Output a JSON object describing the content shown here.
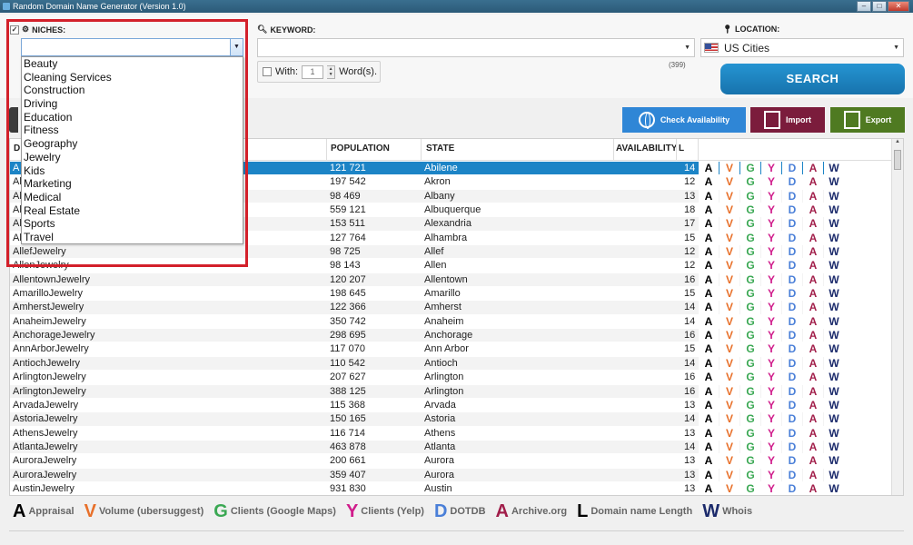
{
  "window": {
    "title": "Random Domain Name Generator (Version 1.0)"
  },
  "niches": {
    "label": "NICHES:",
    "checked": true,
    "value": "",
    "options": [
      "Beauty",
      "Cleaning Services",
      "Construction",
      "Driving",
      "Education",
      "Fitness",
      "Geography",
      "Jewelry",
      "Kids",
      "Marketing",
      "Medical",
      "Real Estate",
      "Sports",
      "Travel"
    ]
  },
  "keyword": {
    "label": "KEYWORD:",
    "value": "",
    "with_label": "With:",
    "with_value": "1",
    "words_label": "Word(s).",
    "count": "(399)"
  },
  "location": {
    "label": "LOCATION:",
    "value": "US Cities"
  },
  "buttons": {
    "search": "SEARCH",
    "check_availability": "Check Availability",
    "import": "Import",
    "export": "Export"
  },
  "colors": {
    "appraisal": "#000000",
    "volume": "#e8702a",
    "google": "#3aa853",
    "yelp": "#d01c8b",
    "dotdb": "#4a7fd8",
    "archive": "#a11e4a",
    "whois": "#1b2a6b",
    "selection": "#1c84c6"
  },
  "table": {
    "headers": {
      "domain": "D",
      "population": "POPULATION",
      "state": "STATE",
      "availability": "AVAILABILITY",
      "length": "L"
    },
    "letters": [
      "A",
      "V",
      "G",
      "Y",
      "D",
      "A",
      "W"
    ],
    "rows": [
      {
        "domain": "A",
        "population": "121 721",
        "state": "Abilene",
        "length": "14",
        "selected": true
      },
      {
        "domain": "Al",
        "population": "197 542",
        "state": "Akron",
        "length": "12"
      },
      {
        "domain": "Al",
        "population": "98 469",
        "state": "Albany",
        "length": "13"
      },
      {
        "domain": "Al",
        "population": "559 121",
        "state": "Albuquerque",
        "length": "18"
      },
      {
        "domain": "Al",
        "population": "153 511",
        "state": "Alexandria",
        "length": "17"
      },
      {
        "domain": "Al",
        "population": "127 764",
        "state": "Alhambra",
        "length": "15"
      },
      {
        "domain": "AllefJewelry",
        "population": "98 725",
        "state": "Allef",
        "length": "12"
      },
      {
        "domain": "AllenJewelry",
        "population": "98 143",
        "state": "Allen",
        "length": "12"
      },
      {
        "domain": "AllentownJewelry",
        "population": "120 207",
        "state": "Allentown",
        "length": "16"
      },
      {
        "domain": "AmarilloJewelry",
        "population": "198 645",
        "state": "Amarillo",
        "length": "15"
      },
      {
        "domain": "AmherstJewelry",
        "population": "122 366",
        "state": "Amherst",
        "length": "14"
      },
      {
        "domain": "AnaheimJewelry",
        "population": "350 742",
        "state": "Anaheim",
        "length": "14"
      },
      {
        "domain": "AnchorageJewelry",
        "population": "298 695",
        "state": "Anchorage",
        "length": "16"
      },
      {
        "domain": "AnnArborJewelry",
        "population": "117 070",
        "state": "Ann Arbor",
        "length": "15"
      },
      {
        "domain": "AntiochJewelry",
        "population": "110 542",
        "state": "Antioch",
        "length": "14"
      },
      {
        "domain": "ArlingtonJewelry",
        "population": "207 627",
        "state": "Arlington",
        "length": "16"
      },
      {
        "domain": "ArlingtonJewelry",
        "population": "388 125",
        "state": "Arlington",
        "length": "16"
      },
      {
        "domain": "ArvadaJewelry",
        "population": "115 368",
        "state": "Arvada",
        "length": "13"
      },
      {
        "domain": "AstoriaJewelry",
        "population": "150 165",
        "state": "Astoria",
        "length": "14"
      },
      {
        "domain": "AthensJewelry",
        "population": "116 714",
        "state": "Athens",
        "length": "13"
      },
      {
        "domain": "AtlantaJewelry",
        "population": "463 878",
        "state": "Atlanta",
        "length": "14"
      },
      {
        "domain": "AuroraJewelry",
        "population": "200 661",
        "state": "Aurora",
        "length": "13"
      },
      {
        "domain": "AuroraJewelry",
        "population": "359 407",
        "state": "Aurora",
        "length": "13"
      },
      {
        "domain": "AustinJewelry",
        "population": "931 830",
        "state": "Austin",
        "length": "13"
      }
    ]
  },
  "legend": [
    {
      "letter": "A",
      "label": "Appraisal",
      "color": "#000000"
    },
    {
      "letter": "V",
      "label": "Volume (ubersuggest)",
      "color": "#e8702a"
    },
    {
      "letter": "G",
      "label": "Clients (Google Maps)",
      "color": "#3aa853"
    },
    {
      "letter": "Y",
      "label": "Clients (Yelp)",
      "color": "#d01c8b"
    },
    {
      "letter": "D",
      "label": "DOTDB",
      "color": "#4a7fd8"
    },
    {
      "letter": "A",
      "label": "Archive.org",
      "color": "#a11e4a"
    },
    {
      "letter": "L",
      "label": "Domain name Length",
      "color": "#000000"
    },
    {
      "letter": "W",
      "label": "Whois",
      "color": "#1b2a6b"
    }
  ]
}
